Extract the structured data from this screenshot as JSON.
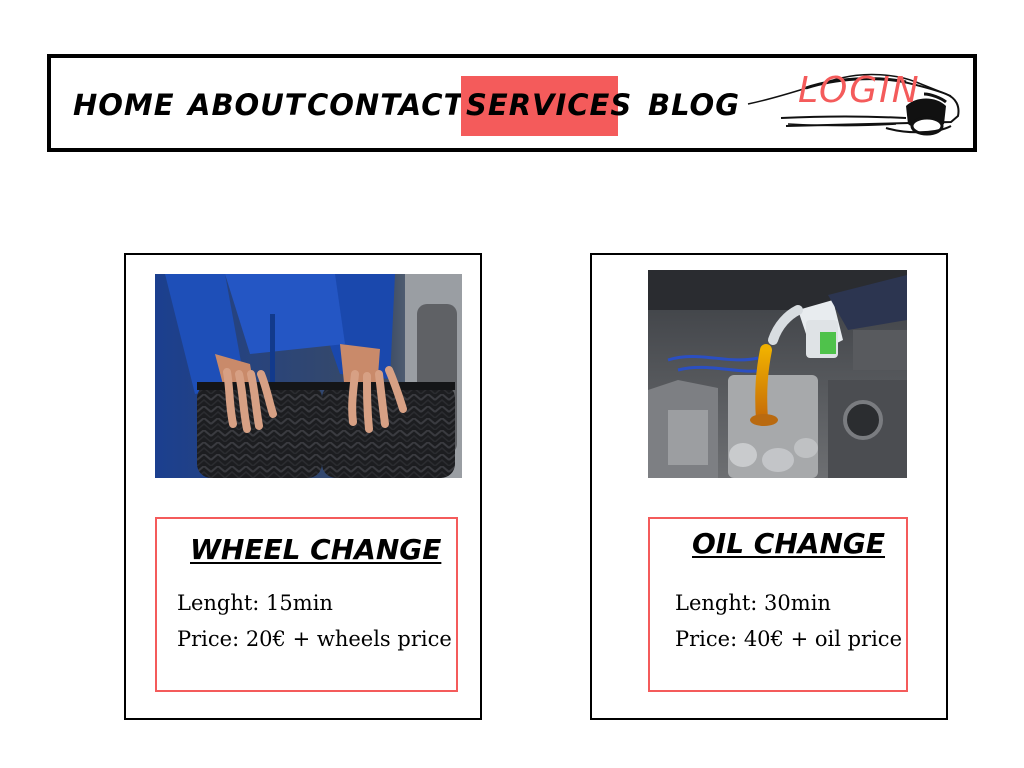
{
  "theme": {
    "accent": "#f45b5b"
  },
  "nav": {
    "items": [
      {
        "label": "HOME"
      },
      {
        "label": "ABOUT"
      },
      {
        "label": "CONTACT"
      },
      {
        "label": "SERVICES",
        "active": true
      },
      {
        "label": "BLOG"
      }
    ],
    "login_label": "LOGIN",
    "logo_icon": "sports-car-logo-icon"
  },
  "services": [
    {
      "title": "WHEEL CHANGE",
      "image": "mechanic-hands-on-tires-photo",
      "length": "Lenght: 15min",
      "price": "Price: 20€ + wheels price"
    },
    {
      "title": "OIL CHANGE",
      "image": "pouring-oil-into-engine-photo",
      "length": "Lenght: 30min",
      "price": "Price: 40€ +  oil price"
    }
  ]
}
